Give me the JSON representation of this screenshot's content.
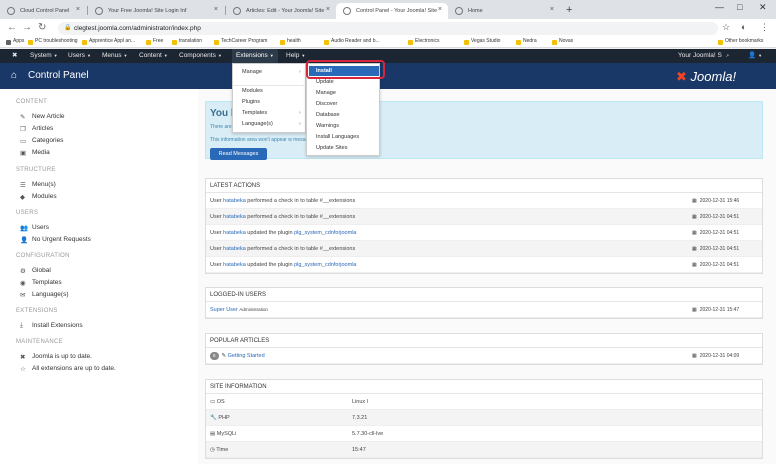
{
  "browser": {
    "tabs": [
      {
        "label": "Cloud Control Panel",
        "active": false
      },
      {
        "label": "Your Free Joomla! Site Login Inf",
        "active": false
      },
      {
        "label": "Articles: Edit - Your Joomla! Site",
        "active": false
      },
      {
        "label": "Control Panel - Your Joomla! Site",
        "active": true
      },
      {
        "label": "Home",
        "active": false
      }
    ],
    "new_tab": "+",
    "url": "clegtest.joomla.com/administrator/index.php",
    "bookmarks": [
      "Apps",
      "PC troubleshooting",
      "Apprentice Appl an...",
      "Free",
      "translation",
      "TechCareer Program",
      "health",
      "Audio Reader and b...",
      "Electronics",
      "Vegas Studio",
      "Nedra",
      "Novas",
      "Other bookmarks"
    ]
  },
  "topnav": {
    "items": [
      "System",
      "Users",
      "Menus",
      "Content",
      "Components",
      "Extensions",
      "Help"
    ],
    "site_label": "Your Joomla! S",
    "user_icon": "user-icon"
  },
  "header": {
    "title": "Control Panel",
    "logo": "Joomla!"
  },
  "extensions_menu": {
    "items": [
      "Manage",
      "Modules",
      "Plugins",
      "Templates",
      "Language(s)"
    ]
  },
  "manage_submenu": {
    "items": [
      "Install",
      "Update",
      "Manage",
      "Discover",
      "Database",
      "Warnings",
      "Install Languages",
      "Update Sites"
    ],
    "highlighted": "Install"
  },
  "sidebar": {
    "sections": [
      {
        "title": "CONTENT",
        "items": [
          {
            "label": "New Article",
            "icon": "pencil-icon"
          },
          {
            "label": "Articles",
            "icon": "stack-icon"
          },
          {
            "label": "Categories",
            "icon": "folder-icon"
          },
          {
            "label": "Media",
            "icon": "image-icon"
          }
        ]
      },
      {
        "title": "STRUCTURE",
        "items": [
          {
            "label": "Menu(s)",
            "icon": "list-icon"
          },
          {
            "label": "Modules",
            "icon": "cube-icon"
          }
        ]
      },
      {
        "title": "USERS",
        "items": [
          {
            "label": "Users",
            "icon": "users-icon"
          },
          {
            "label": "No Urgent Requests",
            "icon": "user-icon"
          }
        ]
      },
      {
        "title": "CONFIGURATION",
        "items": [
          {
            "label": "Global",
            "icon": "cog-icon"
          },
          {
            "label": "Templates",
            "icon": "eye-icon"
          },
          {
            "label": "Language(s)",
            "icon": "comments-icon"
          }
        ]
      },
      {
        "title": "EXTENSIONS",
        "items": [
          {
            "label": "Install Extensions",
            "icon": "upload-icon"
          }
        ]
      },
      {
        "title": "MAINTENANCE",
        "items": [
          {
            "label": "Joomla is up to date.",
            "icon": "joomla-icon"
          },
          {
            "label": "All extensions are up to date.",
            "icon": "star-icon"
          }
        ]
      }
    ]
  },
  "alert": {
    "heading": "You h",
    "line1": "There are                                                                                               attention.",
    "line2": "This information area won't appear w                                                                    messages.",
    "button": "Read Messages"
  },
  "latest_actions": {
    "title": "LATEST ACTIONS",
    "rows": [
      {
        "user": "hatabeka",
        "text": " performed a check in to table #__extensions",
        "link": "",
        "date": "2020-12-31 15:46"
      },
      {
        "user": "hatabeka",
        "text": " performed a check in to table #__extensions",
        "link": "",
        "date": "2020-12-31 04:51"
      },
      {
        "user": "hatabeka",
        "text": " updated the plugin ",
        "link": "plg_system_cdnforjoomla",
        "date": "2020-12-31 04:51"
      },
      {
        "user": "hatabeka",
        "text": " performed a check in to table #__extensions",
        "link": "",
        "date": "2020-12-31 04:51"
      },
      {
        "user": "hatabeka",
        "text": " updated the plugin ",
        "link": "plg_system_cdnforjoomla",
        "date": "2020-12-31 04:51"
      }
    ],
    "prefix": "User "
  },
  "logged_in": {
    "title": "LOGGED-IN USERS",
    "rows": [
      {
        "name": "Super User",
        "role": "Administration",
        "date": "2020-12-31 15:47"
      }
    ]
  },
  "popular": {
    "title": "POPULAR ARTICLES",
    "rows": [
      {
        "hits": "8",
        "title": "Getting Started",
        "date": "2020-12-31 04:09"
      }
    ]
  },
  "site_info": {
    "title": "SITE INFORMATION",
    "rows": [
      {
        "label": "OS",
        "value": "Linux l",
        "icon": "monitor-icon"
      },
      {
        "label": "PHP",
        "value": "7.3.21",
        "icon": "wrench-icon"
      },
      {
        "label": "MySQLi",
        "value": "5.7.30-cll-lve",
        "icon": "database-icon"
      },
      {
        "label": "Time",
        "value": "15:47",
        "icon": "clock-icon"
      }
    ]
  }
}
